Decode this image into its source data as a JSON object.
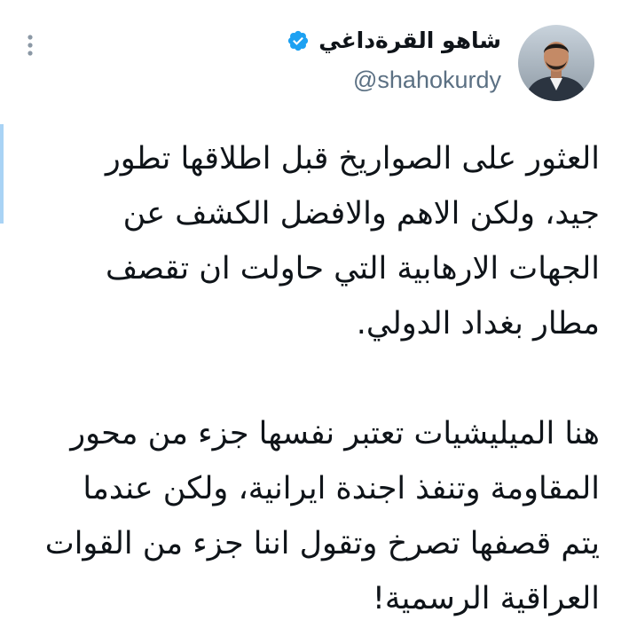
{
  "author": {
    "display_name": "شاهو القرةداغي",
    "handle": "@shahokurdy",
    "verified": true
  },
  "icons": {
    "more": "more-vertical-icon",
    "verified": "verified-badge-icon"
  },
  "tweet": {
    "paragraphs": [
      {
        "lines": [
          "العثور على الصواريخ قبل اطلاقها تطور",
          "جيد، ولكن الاهم والافضل الكشف عن",
          "الجهات الارهابية التي حاولت ان تقصف",
          "مطار بغداد الدولي."
        ]
      },
      {
        "lines": [
          "هنا الميليشيات تعتبر نفسها جزء من محور",
          "المقاومة وتنفذ اجندة ايرانية، ولكن عندما",
          "يتم قصفها تصرخ وتقول اننا جزء من القوات",
          "العراقية الرسمية!"
        ]
      }
    ]
  },
  "colors": {
    "accent": "#1da1f2",
    "accent_bar": "#a9d3f5",
    "text": "#0f1419",
    "secondary_text": "#5b7083"
  }
}
